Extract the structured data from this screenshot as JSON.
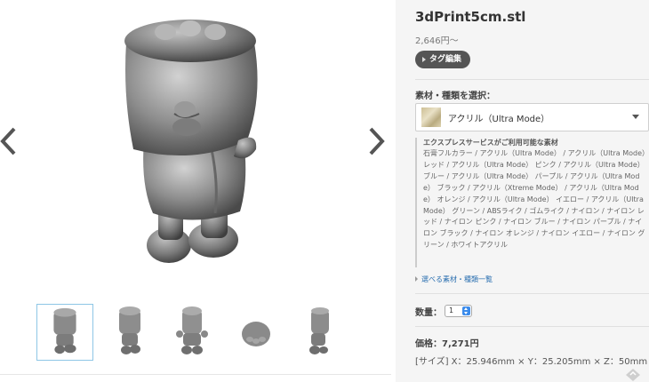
{
  "viewer": {
    "prev_icon": "chevron-left-icon",
    "next_icon": "chevron-right-icon",
    "thumbnails": [
      {
        "view": "front",
        "active": true
      },
      {
        "view": "three-quarter"
      },
      {
        "view": "front-arms"
      },
      {
        "view": "top"
      },
      {
        "view": "side"
      }
    ]
  },
  "product": {
    "title": "3dPrint5cm.stl",
    "price_from": "2,646円〜",
    "tag_button": "タグ編集"
  },
  "material": {
    "section_label": "素材・種類を選択：",
    "selected": "アクリル（Ultra Mode）",
    "express_title": "エクスプレスサービスがご利用可能な素材",
    "express_text": "石膏フルカラー / アクリル（Ultra Mode） / アクリル（Ultra Mode） レッド / アクリル（Ultra Mode） ピンク / アクリル（Ultra Mode） ブルー / アクリル（Ultra Mode） パープル / アクリル（Ultra Mode） ブラック / アクリル（Xtreme Mode） / アクリル（Ultra Mode） オレンジ / アクリル（Ultra Mode） イエロー / アクリル（Ultra Mode） グリーン / ABSライク / ゴムライク / ナイロン / ナイロン レッド / ナイロン ピンク / ナイロン ブルー / ナイロン パープル / ナイロン ブラック / ナイロン オレンジ / ナイロン イエロー / ナイロン グリーン / ホワイトアクリル",
    "link": "選べる素材・種類一覧",
    "swatch_color": "#cdbf94"
  },
  "quantity": {
    "label": "数量：",
    "value": "1"
  },
  "pricing": {
    "price": "価格：7,271円",
    "size": "[サイズ] X：25.946mm × Y：25.205mm × Z：50mm"
  },
  "colors": {
    "panel_bg": "#f5f5f5",
    "tag_button_bg": "#555555",
    "link": "#2a6fb0",
    "active_thumb_border": "#8ec6e6"
  }
}
